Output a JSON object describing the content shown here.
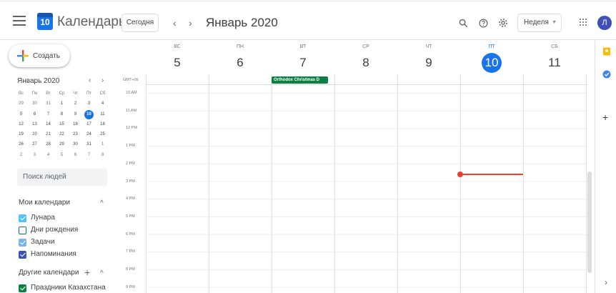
{
  "header": {
    "app_title": "Календарь",
    "logo_day": "10",
    "today_label": "Сегодня",
    "prev_arrow": "‹",
    "next_arrow": "›",
    "period_title": "Январь 2020",
    "view_label": "Неделя",
    "avatar_letter": "Л",
    "icons": [
      "menu-icon",
      "search-icon",
      "help-icon",
      "gear-icon",
      "apps-icon"
    ]
  },
  "sidebar": {
    "create_label": "Создать",
    "mini_calendar": {
      "title": "Январь 2020",
      "prev": "‹",
      "next": "›",
      "weekdays": [
        "Вс",
        "Пн",
        "Вт",
        "Ср",
        "Чт",
        "Пт",
        "Сб"
      ],
      "weeks": [
        [
          "29",
          "30",
          "31",
          "1",
          "2",
          "3",
          "4"
        ],
        [
          "5",
          "6",
          "7",
          "8",
          "9",
          "10",
          "11"
        ],
        [
          "12",
          "13",
          "14",
          "15",
          "16",
          "17",
          "18"
        ],
        [
          "19",
          "20",
          "21",
          "22",
          "23",
          "24",
          "25"
        ],
        [
          "26",
          "27",
          "28",
          "29",
          "30",
          "31",
          "1"
        ],
        [
          "2",
          "3",
          "4",
          "5",
          "6",
          "7",
          "8"
        ]
      ],
      "today": "10"
    },
    "people_search_placeholder": "Поиск людей",
    "my_calendars_title": "Мои календари",
    "my_calendars": [
      {
        "label": "Лунара",
        "color": "#4fc3f7",
        "checked": true
      },
      {
        "label": "Дни рождения",
        "color": "#0b8043",
        "checked": false
      },
      {
        "label": "Задачи",
        "color": "#7cb3e8",
        "checked": true
      },
      {
        "label": "Напоминания",
        "color": "#3f51b5",
        "checked": true
      }
    ],
    "other_calendars_title": "Другие календари",
    "other_calendars": [
      {
        "label": "Праздники Казахстана",
        "color": "#0b8043",
        "checked": true
      }
    ],
    "collapse_caret": "^",
    "add_symbol": "+"
  },
  "week": {
    "timezone": "GMT+06",
    "days": [
      {
        "dow": "ВС",
        "num": "5",
        "today": false
      },
      {
        "dow": "ПН",
        "num": "6",
        "today": false
      },
      {
        "dow": "ВТ",
        "num": "7",
        "today": false
      },
      {
        "dow": "СР",
        "num": "8",
        "today": false
      },
      {
        "dow": "ЧТ",
        "num": "9",
        "today": false
      },
      {
        "dow": "ПТ",
        "num": "10",
        "today": true
      },
      {
        "dow": "СБ",
        "num": "11",
        "today": false
      }
    ],
    "hours": [
      "10 AM",
      "11 AM",
      "12 PM",
      "1 PM",
      "2 PM",
      "3 PM",
      "4 PM",
      "5 PM",
      "6 PM",
      "7 PM",
      "8 PM",
      "9 PM"
    ],
    "all_day_event": "Orthodox Christmas D"
  },
  "colors": {
    "accent": "#1a73e8",
    "now_line": "#ea4335",
    "holiday_event": "#0b8043"
  },
  "side_panel": {
    "plus": "+",
    "expand": "›",
    "icons": [
      "keep-icon",
      "tasks-icon"
    ]
  }
}
